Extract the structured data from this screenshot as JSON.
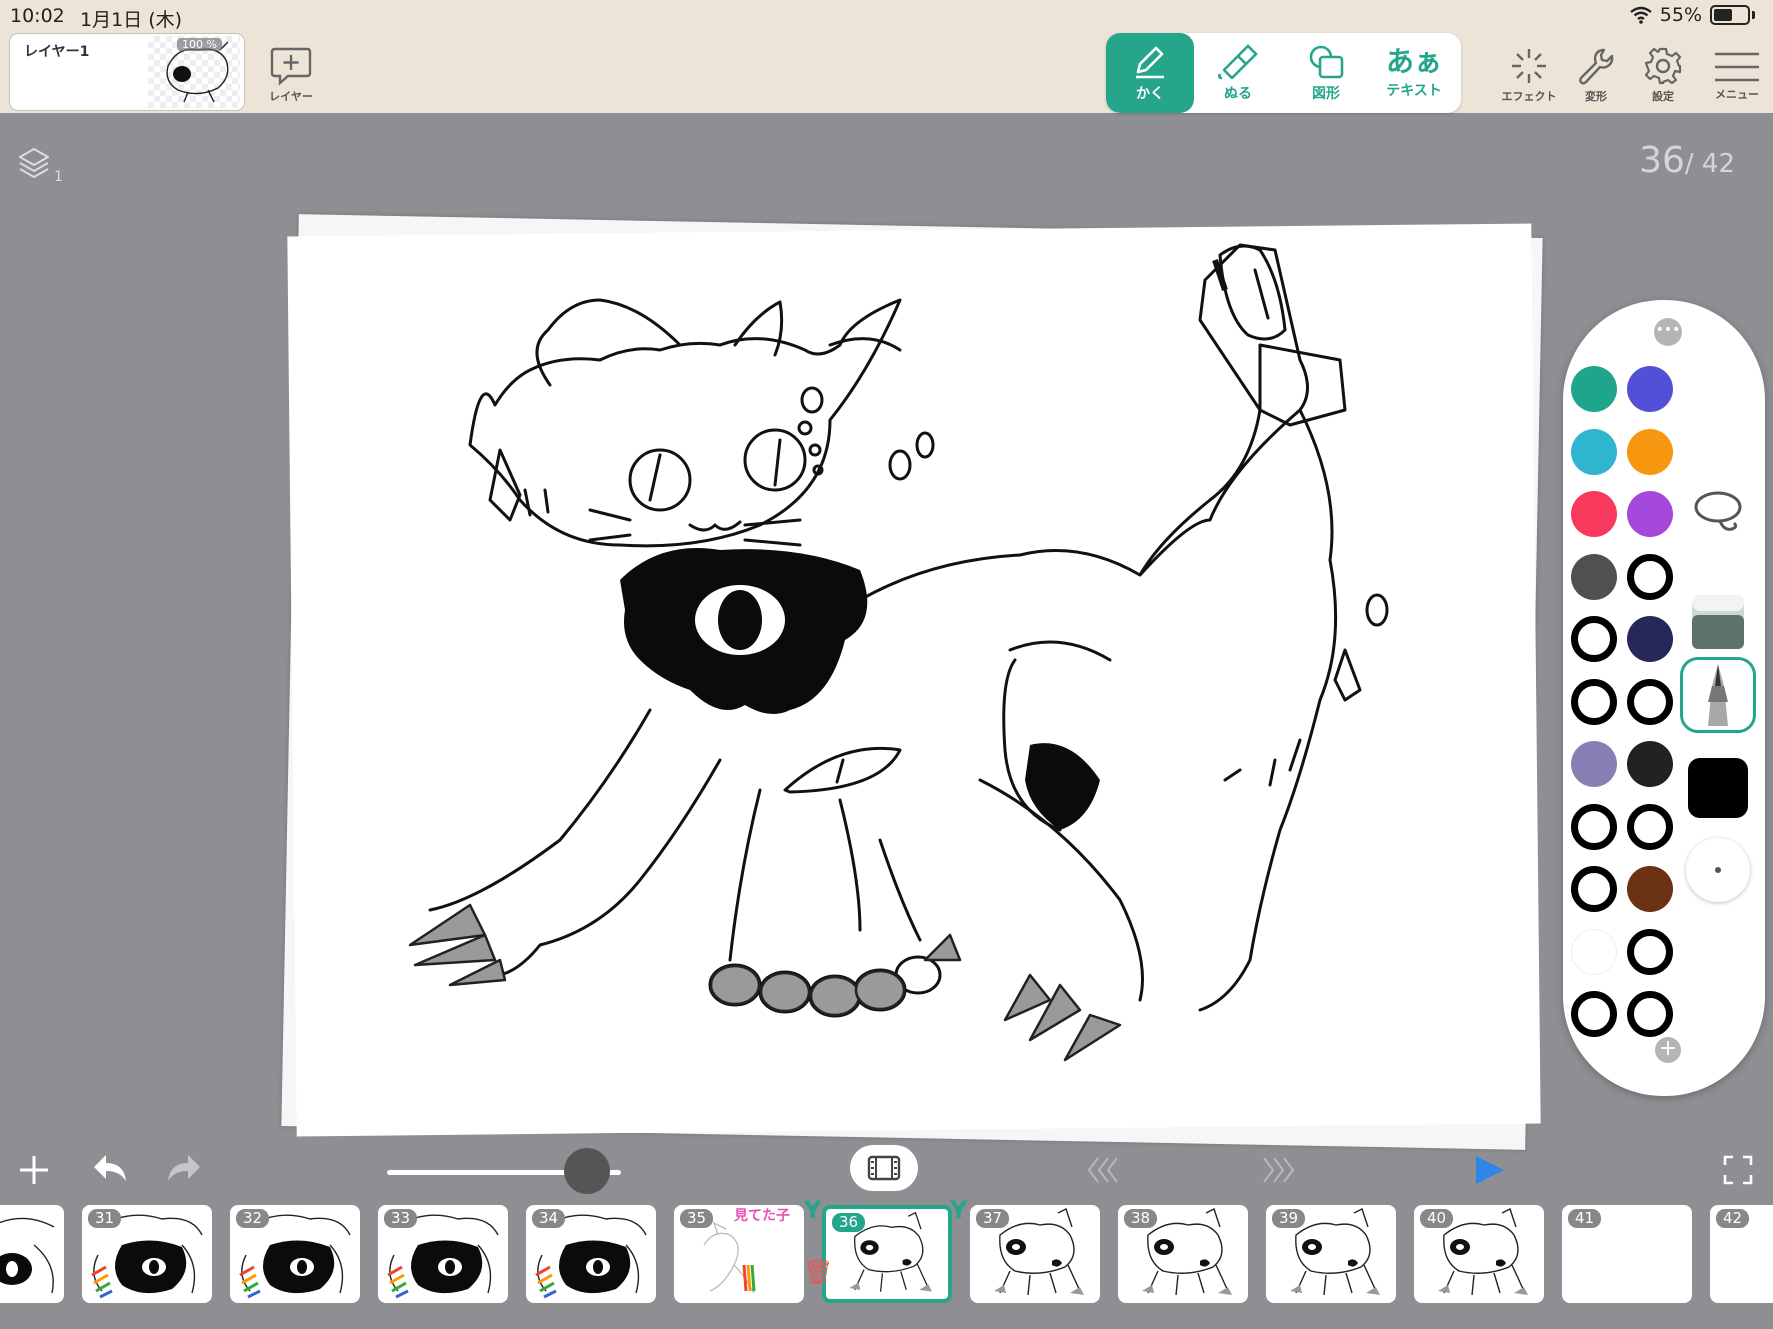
{
  "status": {
    "time": "10:02",
    "date": "1月1日 (木)",
    "battery": "55%"
  },
  "layer_card": {
    "name": "レイヤー1",
    "opacity": "100 %"
  },
  "toolbar": {
    "add_layer_label": "レイヤー",
    "tools": [
      {
        "label": "かく",
        "icon": "pen-icon",
        "active": true
      },
      {
        "label": "ぬる",
        "icon": "fill-icon",
        "active": false
      },
      {
        "label": "図形",
        "icon": "shape-icon",
        "active": false
      },
      {
        "label": "テキスト",
        "glyph": "あぁ",
        "icon": "text-icon",
        "active": false
      }
    ],
    "effect_label": "エフェクト",
    "transform_label": "変形",
    "settings_label": "設定",
    "menu_label": "メニュー"
  },
  "canvas": {
    "layer_count": "1",
    "current_frame": "36",
    "total_frames": "/ 42"
  },
  "palette": {
    "colors": [
      [
        "#1fa58a",
        "#5250d6"
      ],
      [
        "#2fb5d0",
        "#f7960f"
      ],
      [
        "#f8385c",
        "#a548dc"
      ],
      [
        "#505050",
        "ring"
      ],
      [
        "ring",
        "#27275c"
      ],
      [
        "ring",
        "ring"
      ],
      [
        "#8a7fb4",
        "#222222"
      ],
      [
        "ring",
        "ring"
      ],
      [
        "ring",
        "#6b3214"
      ],
      [
        "#ffffff",
        "ring"
      ],
      [
        "ring",
        "ring"
      ]
    ],
    "side_tools": [
      "lasso-icon",
      "eraser-icon",
      "pen-tip-icon",
      "color-black-icon",
      "brush-size-icon"
    ]
  },
  "timeline": {
    "frames": [
      {
        "num": "",
        "type": "partial"
      },
      {
        "num": "31",
        "type": "blob"
      },
      {
        "num": "32",
        "type": "blob"
      },
      {
        "num": "33",
        "type": "blob"
      },
      {
        "num": "34",
        "type": "blob"
      },
      {
        "num": "35",
        "type": "light",
        "tag": "見てた子"
      },
      {
        "num": "36",
        "type": "cat",
        "current": true
      },
      {
        "num": "37",
        "type": "cat"
      },
      {
        "num": "38",
        "type": "cat"
      },
      {
        "num": "39",
        "type": "cat"
      },
      {
        "num": "40",
        "type": "cat"
      },
      {
        "num": "41",
        "type": "empty"
      },
      {
        "num": "42",
        "type": "empty"
      }
    ]
  }
}
